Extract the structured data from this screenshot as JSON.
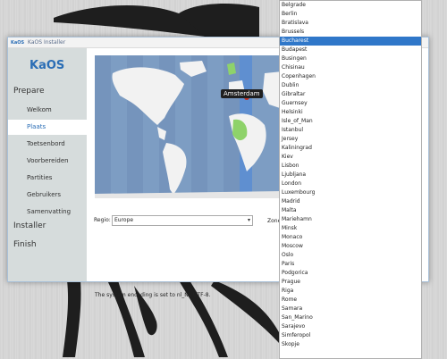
{
  "window": {
    "title": "KaOS Installer",
    "app_icon": "KaOS"
  },
  "sidebar": {
    "logo": "KaOS",
    "groups": {
      "prepare": "Prepare",
      "install": "Installer",
      "finish": "Finish"
    },
    "items": [
      {
        "label": "Welkom"
      },
      {
        "label": "Plaats"
      },
      {
        "label": "Toetsenbord"
      },
      {
        "label": "Voorbereiden"
      },
      {
        "label": "Partities"
      },
      {
        "label": "Gebruikers"
      },
      {
        "label": "Samenvatting"
      }
    ],
    "active_index": 1
  },
  "location": {
    "tooltip": "Amsterdam",
    "region_label": "Regio:",
    "region_value": "Europe",
    "zone_label": "Zone:",
    "encoding_text": "The system encoding is set to nl_NL.UTF-8."
  },
  "dropdown": {
    "options": [
      "Belgrade",
      "Berlin",
      "Bratislava",
      "Brussels",
      "Bucharest",
      "Budapest",
      "Busingen",
      "Chisinau",
      "Copenhagen",
      "Dublin",
      "Gibraltar",
      "Guernsey",
      "Helsinki",
      "Isle_of_Man",
      "Istanbul",
      "Jersey",
      "Kaliningrad",
      "Kiev",
      "Lisbon",
      "Ljubljana",
      "London",
      "Luxembourg",
      "Madrid",
      "Malta",
      "Mariehamn",
      "Minsk",
      "Monaco",
      "Moscow",
      "Oslo",
      "Paris",
      "Podgorica",
      "Prague",
      "Riga",
      "Rome",
      "Samara",
      "San_Marino",
      "Sarajevo",
      "Simferopol",
      "Skopje"
    ],
    "selected": "Bucharest"
  },
  "colors": {
    "accent": "#2f77c9",
    "sidebar_bg": "#d6dcdc",
    "map_ocean": "#7d9dc3",
    "map_land": "#f2f2f2",
    "tz_highlight": "#5f8fd0",
    "region_green": "#8ed26a"
  }
}
